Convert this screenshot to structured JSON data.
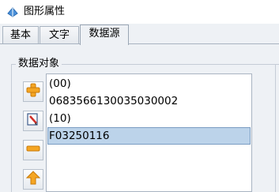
{
  "window": {
    "title": "图形属性"
  },
  "tabs": [
    {
      "label": "基本"
    },
    {
      "label": "文字"
    },
    {
      "label": "数据源",
      "active": true
    }
  ],
  "group": {
    "label": "数据对象"
  },
  "list": {
    "items": [
      {
        "text": "(00)"
      },
      {
        "text": "0683566130035030002"
      },
      {
        "text": "(10)"
      },
      {
        "text": "F03250116",
        "selected": true
      }
    ]
  },
  "buttons": [
    {
      "icon": "add-icon"
    },
    {
      "icon": "edit-icon"
    },
    {
      "icon": "remove-icon"
    },
    {
      "icon": "move-up-icon"
    }
  ],
  "colors": {
    "selection": "#bcd3ea",
    "icon_orange": "#f5a623"
  }
}
